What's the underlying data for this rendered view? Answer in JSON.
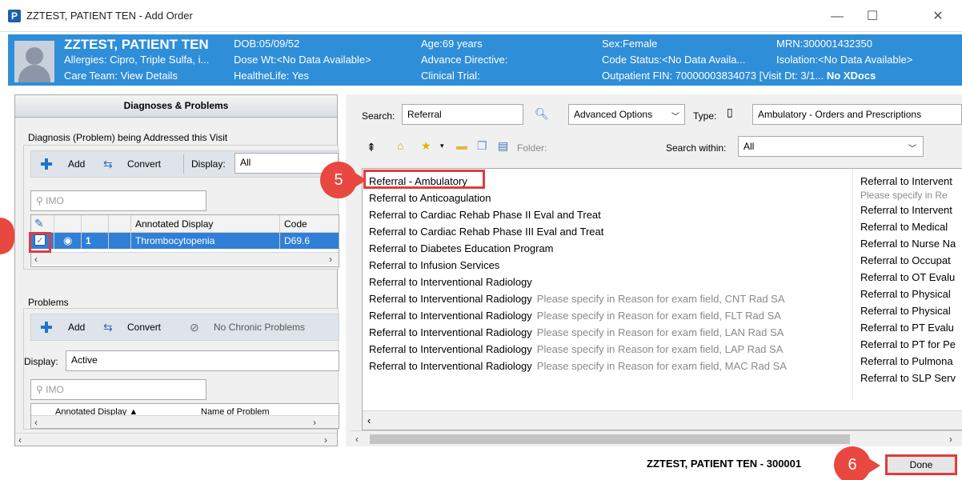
{
  "window": {
    "app_icon": "P",
    "title": "ZZTEST, PATIENT TEN - Add Order",
    "minimize": "—",
    "maximize": "☐",
    "close": "✕"
  },
  "banner": {
    "name": "ZZTEST, PATIENT TEN",
    "allergies": "Allergies: Cipro, Triple Sulfa, i...",
    "care_team": "Care Team: View Details",
    "dob": "DOB:05/09/52",
    "dose_wt": "Dose Wt:<No Data Available>",
    "healthelife": "HealtheLife: Yes",
    "age": "Age:69 years",
    "advance_directive": "Advance Directive:",
    "clinical_trial": "Clinical Trial:",
    "sex": "Sex:Female",
    "code_status": "Code Status:<No Data Availa...",
    "outpatient_fin": "Outpatient FIN: 70000003834073 [Visit Dt: 3/1...",
    "no_xdocs": "No XDocs",
    "mrn": "MRN:300001432350",
    "isolation": "Isolation:<No Data Available>"
  },
  "left_pane": {
    "header": "Diagnoses & Problems",
    "diagnosis_group_label": "Diagnosis (Problem) being Addressed this Visit",
    "add_label": "Add",
    "convert_label": "Convert",
    "display_label": "Display:",
    "display_value": "All",
    "imo_placeholder": "IMO",
    "grid_headers": [
      "Annotated Display",
      "Code"
    ],
    "diagnosis_row": {
      "number": "1",
      "display": "Thrombocytopenia",
      "code": "D69.6"
    },
    "problems_label": "Problems",
    "no_chronic_label": "No Chronic Problems",
    "problems_display_value": "Active",
    "problems_grid_headers": [
      "Annotated Display ▲",
      "Name of Problem"
    ]
  },
  "right_pane": {
    "search_label": "Search:",
    "search_value": "Referral",
    "advanced_options": "Advanced Options",
    "type_label": "Type:",
    "type_value": "Ambulatory - Orders and Prescriptions",
    "folder_label": "Folder:",
    "search_within_label": "Search within:",
    "search_within_value": "All",
    "results_col1": [
      {
        "name": "Referral - Ambulatory",
        "detail": ""
      },
      {
        "name": "Referral to Anticoagulation",
        "detail": ""
      },
      {
        "name": "Referral to Cardiac Rehab Phase II Eval and Treat",
        "detail": ""
      },
      {
        "name": "Referral to Cardiac Rehab Phase III Eval and Treat",
        "detail": ""
      },
      {
        "name": "Referral to Diabetes Education Program",
        "detail": ""
      },
      {
        "name": "Referral to Infusion Services",
        "detail": ""
      },
      {
        "name": "Referral to Interventional Radiology",
        "detail": ""
      },
      {
        "name": "Referral to Interventional Radiology",
        "detail": "Please specify in Reason for exam field, CNT Rad SA"
      },
      {
        "name": "Referral to Interventional Radiology",
        "detail": "Please specify in Reason for exam field, FLT Rad SA"
      },
      {
        "name": "Referral to Interventional Radiology",
        "detail": "Please specify in Reason for exam field, LAN Rad SA"
      },
      {
        "name": "Referral to Interventional Radiology",
        "detail": "Please specify in Reason for exam field, LAP Rad SA"
      },
      {
        "name": "Referral to Interventional Radiology",
        "detail": "Please specify in Reason for exam field, MAC Rad SA"
      }
    ],
    "results_col2": [
      "Referral to Intervent",
      "Please specify in Re",
      "Referral to Intervent",
      "Referral to Medical",
      "Referral to Nurse Na",
      "Referral to Occupat",
      "Referral to OT Evalu",
      "Referral to Physical",
      "Referral to Physical",
      "Referral to PT Evalu",
      "Referral to PT for Pe",
      "Referral to Pulmona",
      "Referral to SLP Serv"
    ]
  },
  "footer": {
    "status_name": "ZZTEST, PATIENT TEN - 300001",
    "done_label": "Done"
  },
  "callouts": {
    "step5": "5",
    "step6": "6"
  },
  "icons": {
    "search": "magnifier-icon",
    "home": "home-icon",
    "favorite": "star-icon",
    "folder": "folder-icon"
  },
  "colors": {
    "banner": "#2f8ed8",
    "selection": "#2f7fd6",
    "callout": "#e8483f"
  }
}
